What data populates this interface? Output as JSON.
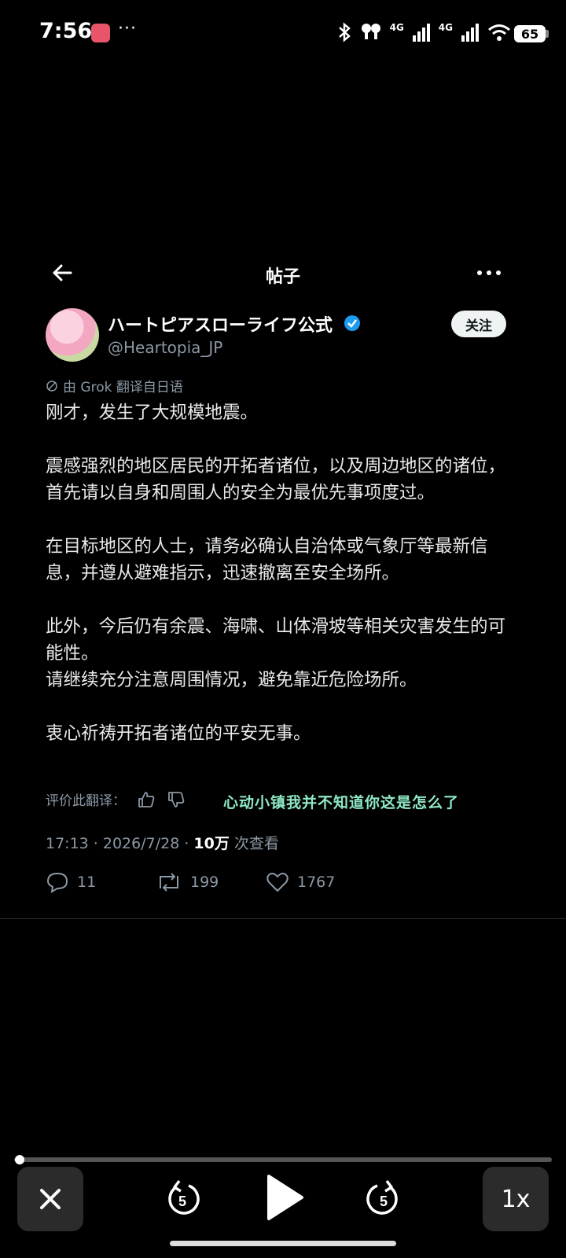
{
  "status_bar": {
    "time": "7:56",
    "more": "···",
    "net1": "4G",
    "net2": "4G",
    "battery": "65"
  },
  "header": {
    "title": "帖子"
  },
  "post": {
    "author_name": "ハートピアスローライフ公式",
    "author_handle": "@Heartopia_JP",
    "follow_label": "关注",
    "translation_note": "由 Grok 翻译自日语",
    "body": "刚才，发生了大规模地震。\n\n震感强烈的地区居民的开拓者诸位，以及周边地区的诸位，首先请以自身和周围人的安全为最优先事项度过。\n\n在目标地区的人士，请务必确认自治体或气象厅等最新信息，并遵从避难指示，迅速撤离至安全场所。\n\n此外，今后仍有余震、海啸、山体滑坡等相关灾害发生的可能性。\n请继续充分注意周围情况，避免靠近危险场所。\n\n衷心祈祷开拓者诸位的平安无事。",
    "rate_label": "评价此翻译：",
    "overlay_caption": "心动小镇我并不知道你这是怎么了",
    "time": "17:13 · 2026/7/28 · ",
    "views_count": "10万",
    "views_label": " 次查看",
    "replies": "11",
    "reposts": "199",
    "likes": "1767"
  },
  "player": {
    "progress": 0.01,
    "rewind_seconds": "5",
    "forward_seconds": "5",
    "speed_label": "1x"
  },
  "colors": {
    "accent_verified": "#1d9bf0",
    "overlay": "#8ee8c4"
  }
}
